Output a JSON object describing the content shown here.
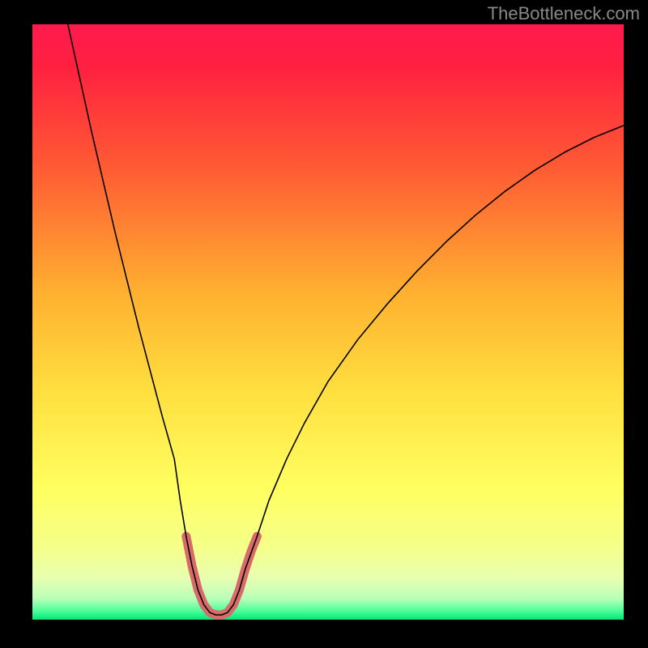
{
  "watermark": "TheBottleneck.com",
  "chart_data": {
    "type": "line",
    "title": "",
    "xlabel": "",
    "ylabel": "",
    "xlim": [
      0,
      100
    ],
    "ylim": [
      0,
      100
    ],
    "gradient_stops": [
      {
        "offset": 0.0,
        "color": "#ff1a4d"
      },
      {
        "offset": 0.07,
        "color": "#ff2040"
      },
      {
        "offset": 0.25,
        "color": "#ff5e33"
      },
      {
        "offset": 0.45,
        "color": "#ffb030"
      },
      {
        "offset": 0.62,
        "color": "#ffe040"
      },
      {
        "offset": 0.78,
        "color": "#ffff60"
      },
      {
        "offset": 0.88,
        "color": "#f5ff8a"
      },
      {
        "offset": 0.93,
        "color": "#e8ffb0"
      },
      {
        "offset": 0.965,
        "color": "#b8ffb8"
      },
      {
        "offset": 0.985,
        "color": "#4dff9a"
      },
      {
        "offset": 1.0,
        "color": "#00e676"
      }
    ],
    "series": [
      {
        "name": "bottleneck-curve",
        "stroke": "#000000",
        "stroke_width": 1.6,
        "points": [
          {
            "x": 6.0,
            "y": 100.0
          },
          {
            "x": 8.0,
            "y": 91.0
          },
          {
            "x": 10.0,
            "y": 82.0
          },
          {
            "x": 12.0,
            "y": 73.5
          },
          {
            "x": 14.0,
            "y": 65.0
          },
          {
            "x": 16.0,
            "y": 57.0
          },
          {
            "x": 18.0,
            "y": 49.0
          },
          {
            "x": 20.0,
            "y": 41.5
          },
          {
            "x": 22.0,
            "y": 34.0
          },
          {
            "x": 24.0,
            "y": 27.0
          },
          {
            "x": 25.0,
            "y": 20.0
          },
          {
            "x": 26.0,
            "y": 14.0
          },
          {
            "x": 27.0,
            "y": 9.0
          },
          {
            "x": 28.0,
            "y": 5.0
          },
          {
            "x": 29.0,
            "y": 2.5
          },
          {
            "x": 30.0,
            "y": 1.2
          },
          {
            "x": 31.0,
            "y": 0.8
          },
          {
            "x": 32.0,
            "y": 0.8
          },
          {
            "x": 33.0,
            "y": 1.2
          },
          {
            "x": 34.0,
            "y": 2.5
          },
          {
            "x": 35.0,
            "y": 5.0
          },
          {
            "x": 36.0,
            "y": 8.5
          },
          {
            "x": 38.0,
            "y": 14.0
          },
          {
            "x": 40.0,
            "y": 20.0
          },
          {
            "x": 43.0,
            "y": 27.0
          },
          {
            "x": 46.0,
            "y": 33.0
          },
          {
            "x": 50.0,
            "y": 40.0
          },
          {
            "x": 55.0,
            "y": 47.0
          },
          {
            "x": 60.0,
            "y": 53.0
          },
          {
            "x": 65.0,
            "y": 58.5
          },
          {
            "x": 70.0,
            "y": 63.5
          },
          {
            "x": 75.0,
            "y": 68.0
          },
          {
            "x": 80.0,
            "y": 72.0
          },
          {
            "x": 85.0,
            "y": 75.5
          },
          {
            "x": 90.0,
            "y": 78.5
          },
          {
            "x": 95.0,
            "y": 81.0
          },
          {
            "x": 100.0,
            "y": 83.0
          }
        ]
      },
      {
        "name": "highlight-band",
        "stroke": "#d96a6a",
        "stroke_width": 11,
        "points": [
          {
            "x": 26.0,
            "y": 14.0
          },
          {
            "x": 27.0,
            "y": 9.0
          },
          {
            "x": 28.0,
            "y": 5.0
          },
          {
            "x": 29.0,
            "y": 2.5
          },
          {
            "x": 30.0,
            "y": 1.2
          },
          {
            "x": 31.0,
            "y": 0.8
          },
          {
            "x": 32.0,
            "y": 0.8
          },
          {
            "x": 33.0,
            "y": 1.2
          },
          {
            "x": 34.0,
            "y": 2.5
          },
          {
            "x": 35.0,
            "y": 5.0
          },
          {
            "x": 36.0,
            "y": 8.5
          },
          {
            "x": 37.0,
            "y": 11.5
          },
          {
            "x": 38.0,
            "y": 14.0
          }
        ]
      }
    ]
  }
}
